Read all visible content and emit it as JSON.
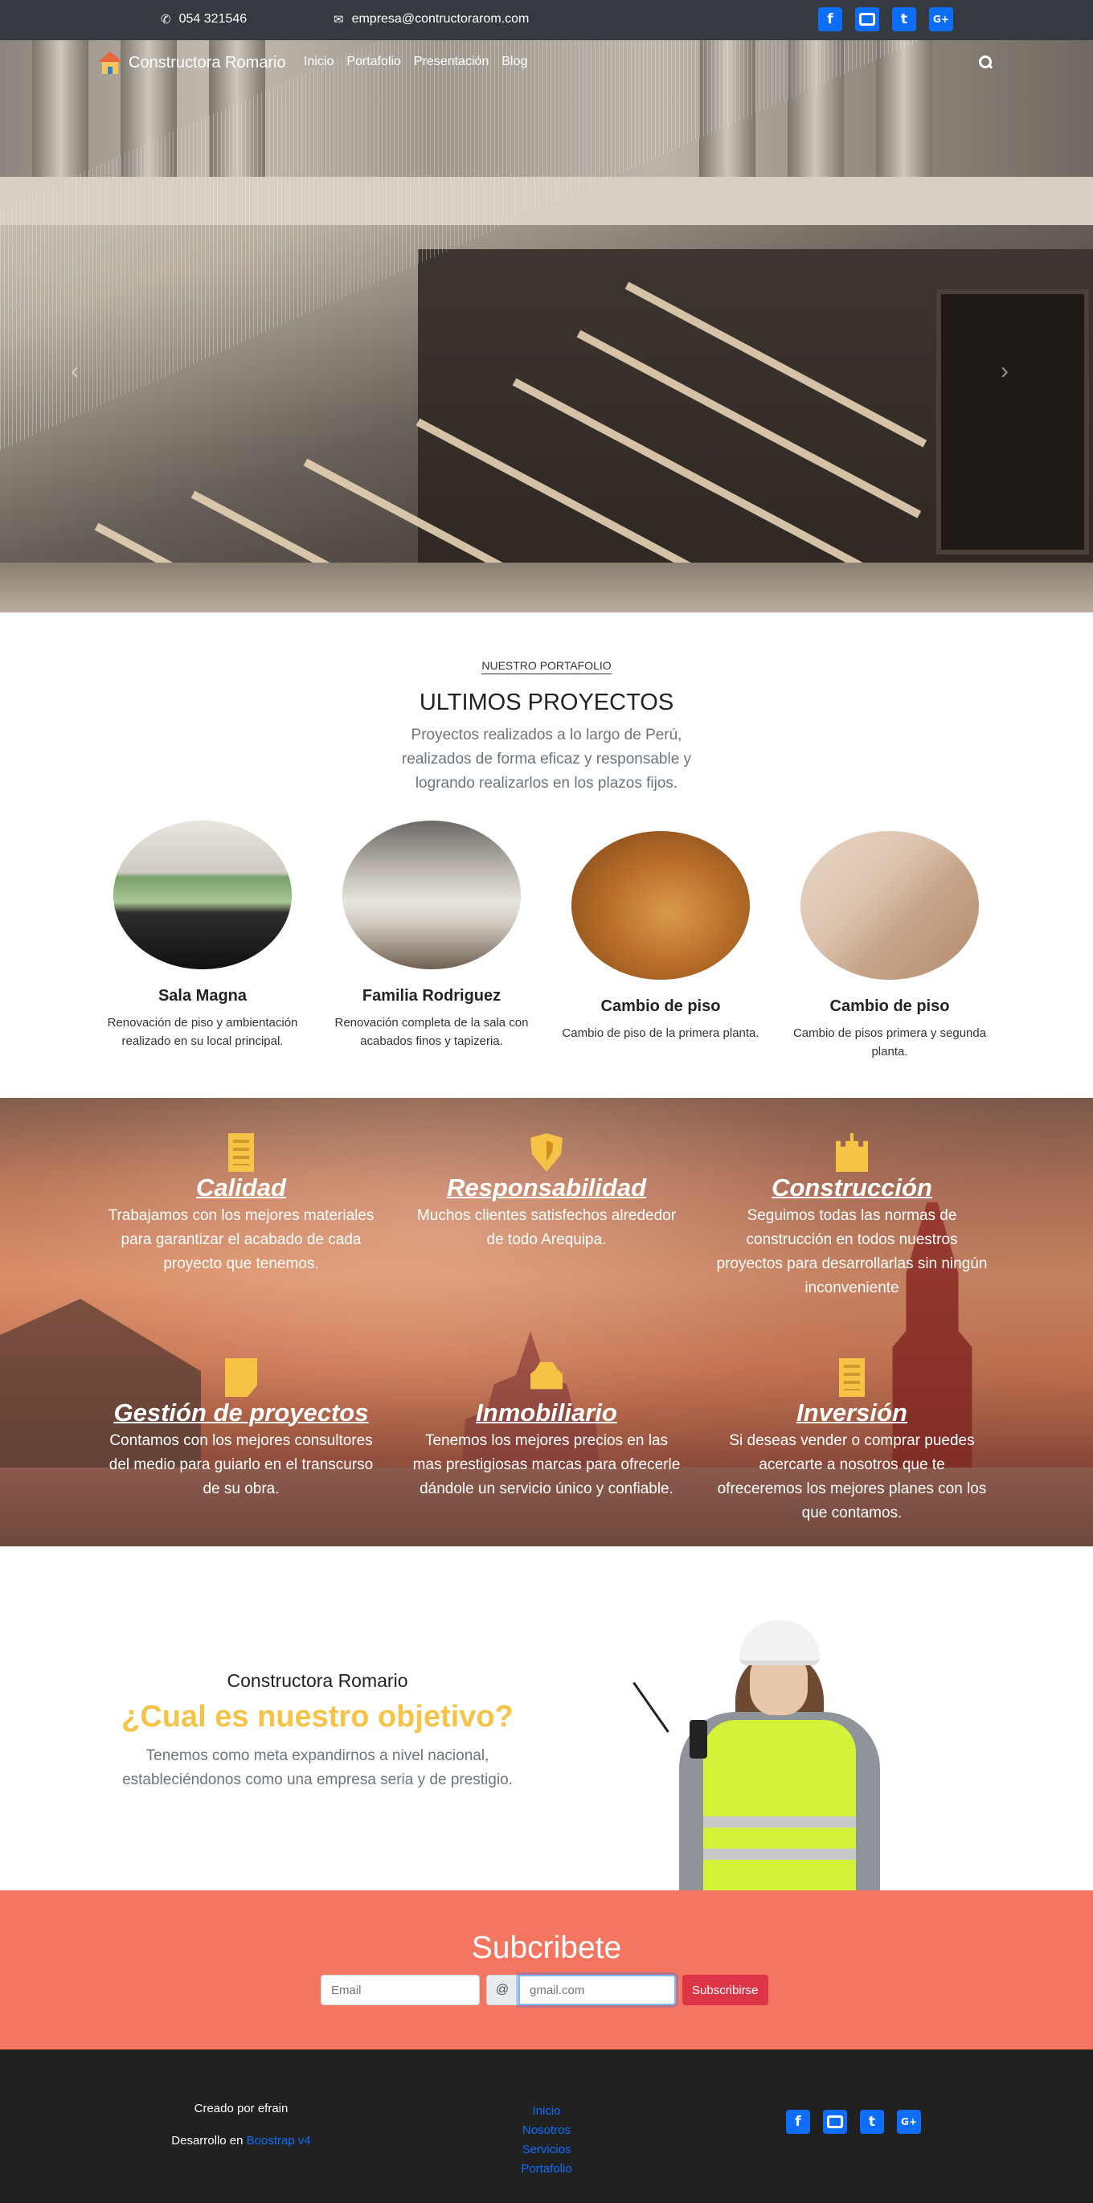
{
  "topbar": {
    "phone": "054 321546",
    "email": "empresa@contructorarom.com",
    "social": [
      "facebook-icon",
      "youtube-icon",
      "twitter-icon",
      "google-plus-icon"
    ]
  },
  "navbar": {
    "brand": "Constructora Romario",
    "links": [
      "Inicio",
      "Portafolio",
      "Presentación",
      "Blog"
    ]
  },
  "carousel": {
    "slides": 3,
    "active_index": 1
  },
  "portfolio": {
    "kicker": "NUESTRO PORTAFOLIO",
    "title": "ULTIMOS PROYECTOS",
    "description": "Proyectos realizados a lo largo de Perú, realizados de forma eficaz y responsable y logrando realizarlos en los plazos fijos.",
    "projects": [
      {
        "title": "Sala Magna",
        "text": "Renovación de piso y ambientación realizado en su local principal."
      },
      {
        "title": "Familia Rodriguez",
        "text": "Renovación completa de la sala con acabados finos y tapizeria."
      },
      {
        "title": "Cambio de piso",
        "text": "Cambio de piso de la primera planta."
      },
      {
        "title": "Cambio de piso",
        "text": "Cambio de pisos primera y segunda planta."
      }
    ]
  },
  "features": [
    {
      "icon": "building-icon",
      "title": "Calidad",
      "text": "Trabajamos con los mejores materiales para garantizar el acabado de cada proyecto que tenemos."
    },
    {
      "icon": "shield-icon",
      "title": "Responsabilidad",
      "text": "Muchos clientes satisfechos alrededor de todo Arequipa."
    },
    {
      "icon": "castle-icon",
      "title": "Construcción",
      "text": "Seguimos todas las normas de construcción en todos nuestros proyectos para desarrollarlas sin ningún inconveniente"
    },
    {
      "icon": "sticky-note-icon",
      "title": "Gestión de proyectos",
      "text": "Contamos con los mejores consultores del medio para guiarlo en el transcurso de su obra."
    },
    {
      "icon": "car-icon",
      "title": "Inmobiliario",
      "text": "Tenemos los mejores precios en las mas prestigiosas marcas para ofrecerle dándole un servicio único y confiable."
    },
    {
      "icon": "building-icon",
      "title": "Inversión",
      "text": "Si deseas vender o comprar puedes acercarte a nosotros que te ofreceremos los mejores planes con los que contamos."
    }
  ],
  "objective": {
    "brand": "Constructora Romario",
    "title": "¿Cual es nuestro objetivo?",
    "text": "Tenemos como meta expandirnos a nivel nacional, estableciéndonos como una empresa seria y de prestigio."
  },
  "subscribe": {
    "title": "Subcribete",
    "email_placeholder": "Email",
    "at": "@",
    "domain_placeholder": "gmail.com",
    "button": "Subscribirse"
  },
  "footer": {
    "created": "Creado por efrain",
    "dev_prefix": "Desarrollo en",
    "dev_link": "Boostrap v4",
    "links": [
      "Inicio",
      "Nosotros",
      "Servicios",
      "Portafolio"
    ],
    "social": [
      "facebook-icon",
      "youtube-icon",
      "twitter-icon",
      "google-plus-icon"
    ]
  },
  "colors": {
    "topbar": "#343a40",
    "accent": "#f6c347",
    "subscribe_bg": "#f47560",
    "footer_bg": "#212121",
    "link": "#0d6efd",
    "button": "#dc3545"
  }
}
